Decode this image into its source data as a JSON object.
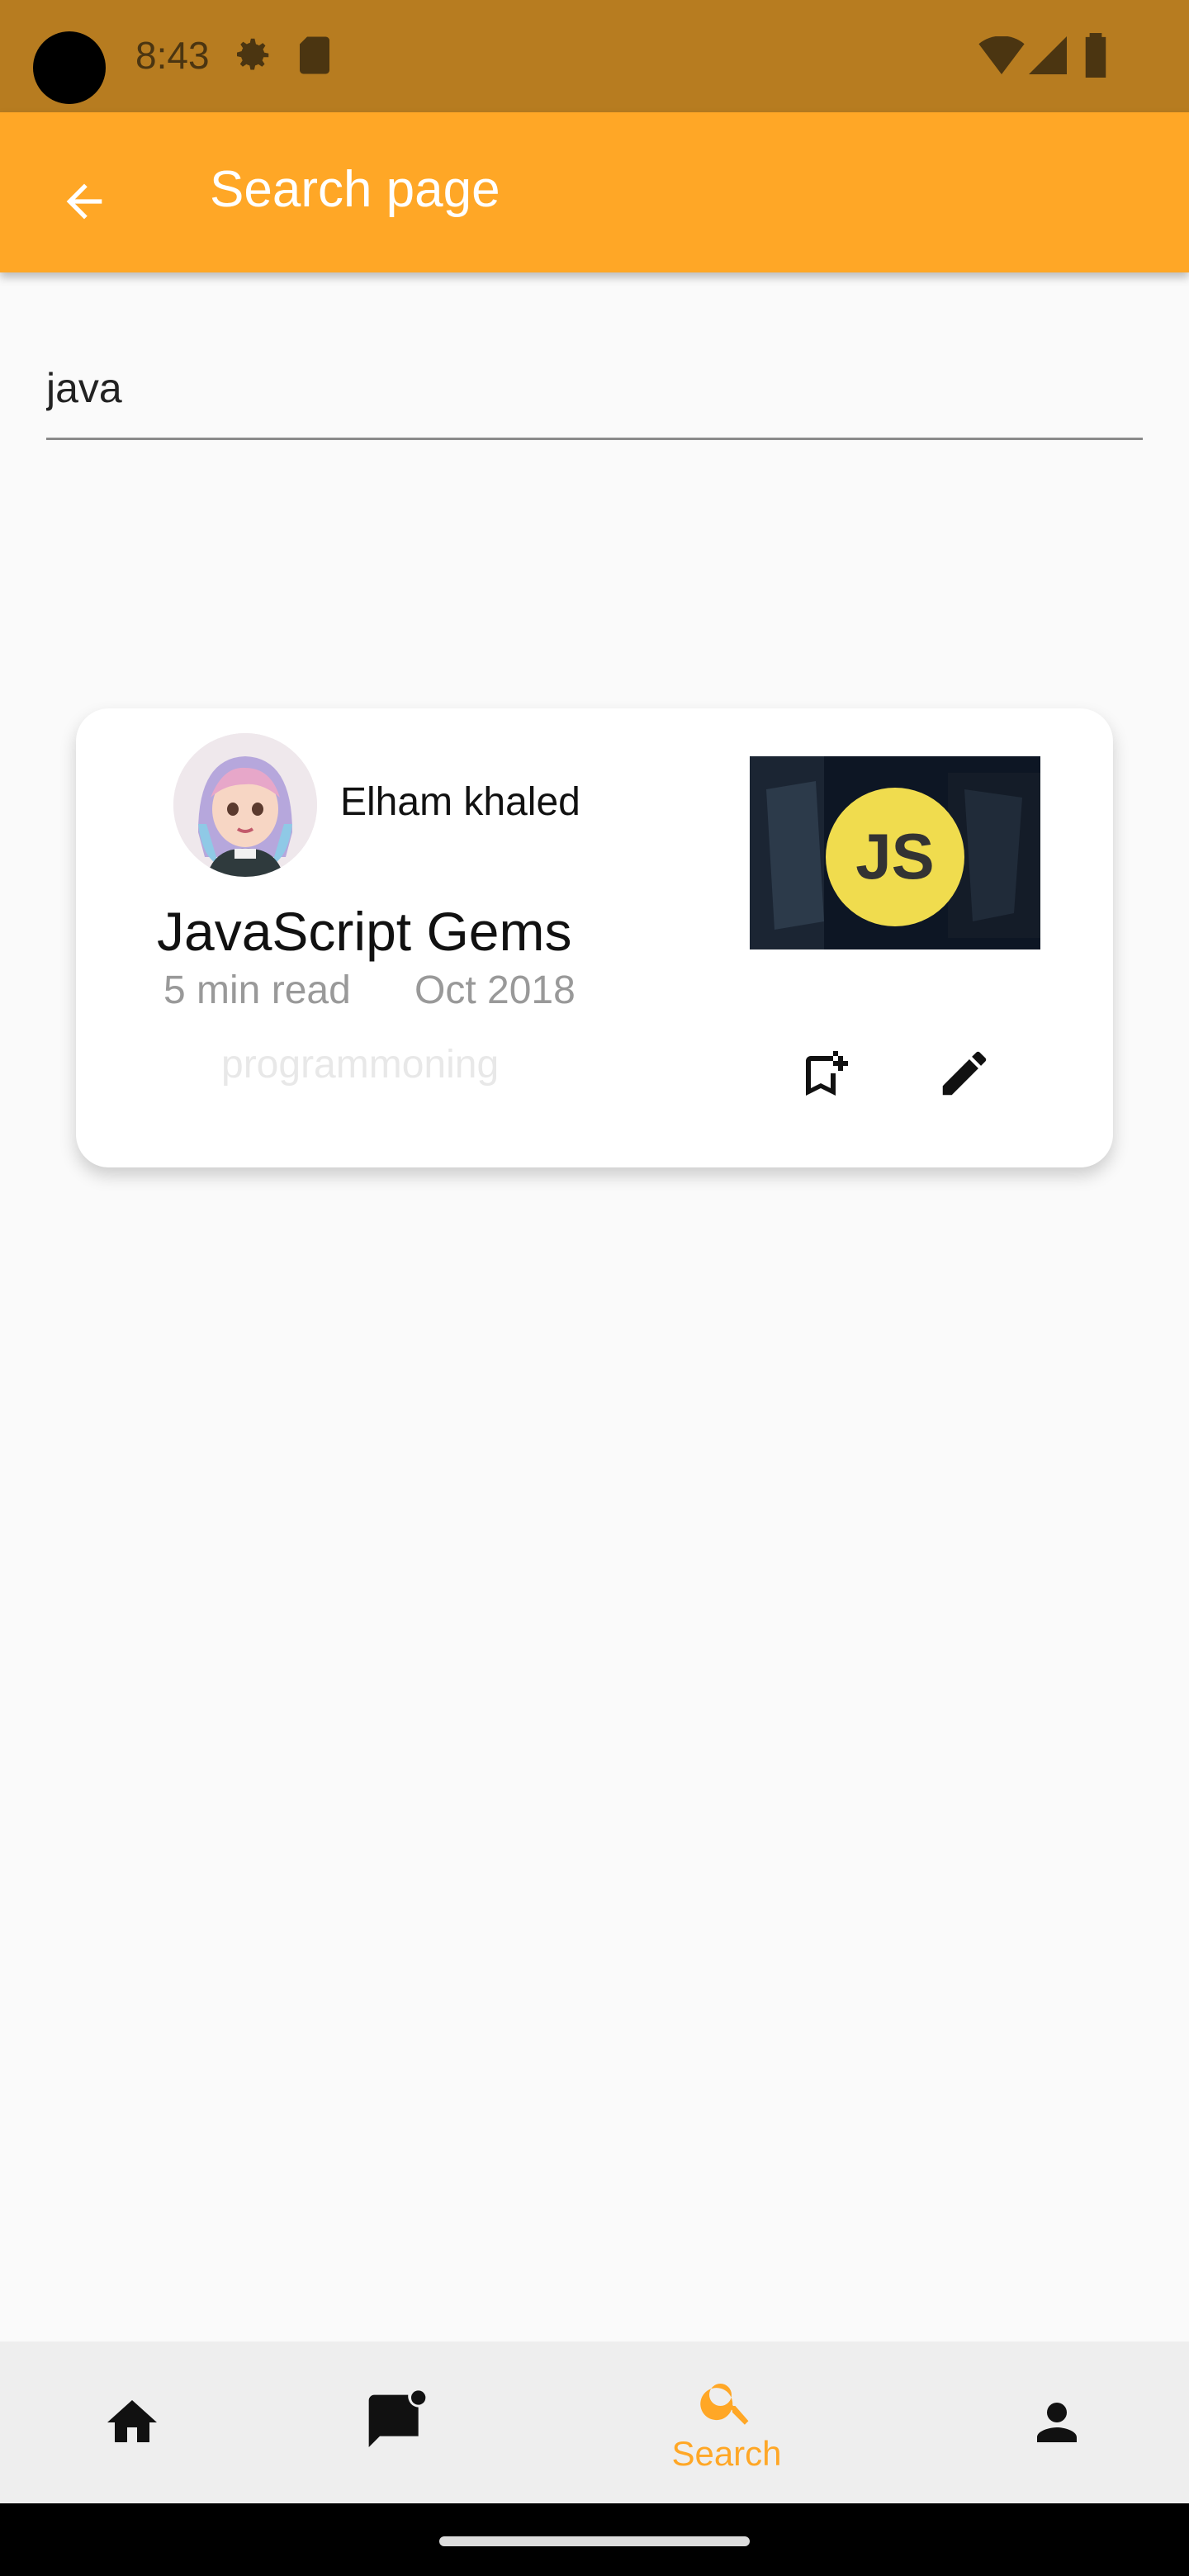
{
  "status_bar": {
    "time": "8:43"
  },
  "app_bar": {
    "title": "Search page"
  },
  "search": {
    "value": "java",
    "placeholder": ""
  },
  "article": {
    "author": "Elham khaled",
    "title": "JavaScript Gems",
    "read_time": "5 min read",
    "date": "Oct 2018",
    "tag": "programmoning",
    "thumbnail_text": "JS"
  },
  "bottom_nav": {
    "items": [
      {
        "icon": "home-icon",
        "label": ""
      },
      {
        "icon": "chat-icon",
        "label": ""
      },
      {
        "icon": "search-icon",
        "label": "Search",
        "active": true
      },
      {
        "icon": "person-icon",
        "label": ""
      }
    ]
  },
  "colors": {
    "accent": "#ffa726",
    "status_bar": "#b77c20"
  }
}
